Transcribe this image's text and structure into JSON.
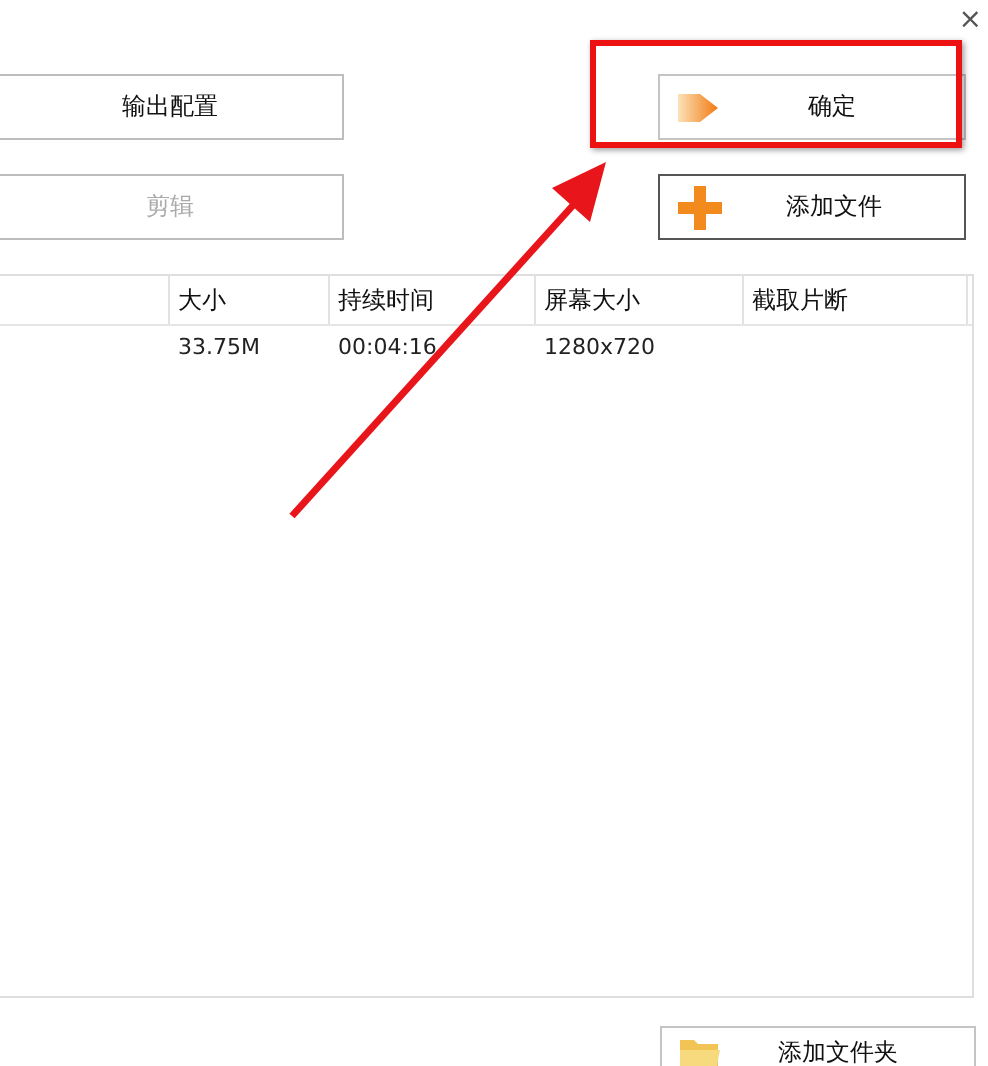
{
  "close": "×",
  "left_buttons": [
    {
      "label": "输出配置",
      "disabled": false
    },
    {
      "label": "剪辑",
      "disabled": true
    }
  ],
  "right_buttons": [
    {
      "label": "确定",
      "kind": "arrow",
      "highlighted": true
    },
    {
      "label": "添加文件",
      "kind": "plus",
      "highlighted": false
    }
  ],
  "table": {
    "columns": [
      "大小",
      "持续时间",
      "屏幕大小",
      "截取片断"
    ],
    "rows": [
      [
        "33.75M",
        "00:04:16",
        "1280x720"
      ]
    ]
  },
  "bottom_button": {
    "label": "添加文件夹",
    "kind": "folder"
  },
  "pointer_arrow": true
}
